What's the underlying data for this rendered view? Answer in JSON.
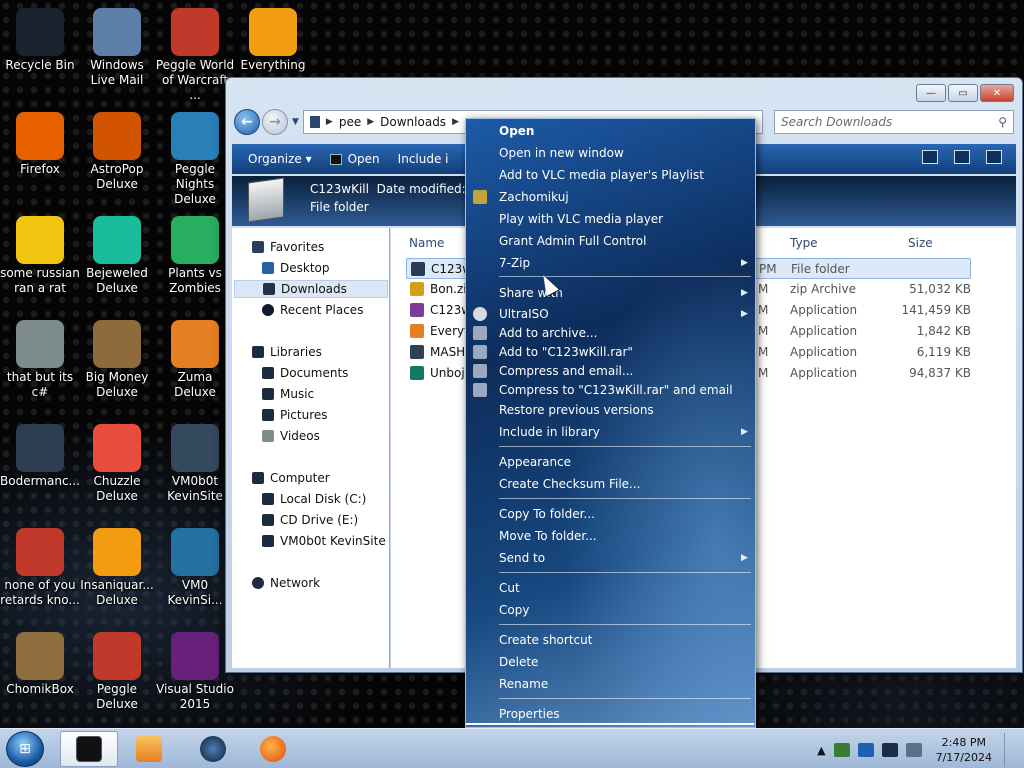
{
  "desktop": {
    "icons": [
      {
        "label": "Recycle Bin",
        "color": "#1b2330"
      },
      {
        "label": "Windows Live Mail",
        "color": "#5b7fa8"
      },
      {
        "label": "Peggle World of Warcraft ...",
        "color": "#c0392b"
      },
      {
        "label": "Everything",
        "color": "#f39c12"
      },
      {
        "label": "Firefox",
        "color": "#e66000"
      },
      {
        "label": "AstroPop Deluxe",
        "color": "#d35400"
      },
      {
        "label": "Peggle Nights Deluxe",
        "color": "#2980b9"
      },
      {
        "label": "some russian ran a rat",
        "color": "#f1c40f"
      },
      {
        "label": "Bejeweled Deluxe",
        "color": "#1abc9c"
      },
      {
        "label": "Plants vs Zombies",
        "color": "#27ae60"
      },
      {
        "label": "that but its c#",
        "color": "#7f8c8d"
      },
      {
        "label": "Big Money Deluxe",
        "color": "#8e6b3a"
      },
      {
        "label": "Zuma Deluxe",
        "color": "#e67e22"
      },
      {
        "label": "Bodermanc...",
        "color": "#2c3e50"
      },
      {
        "label": "Chuzzle Deluxe",
        "color": "#e74c3c"
      },
      {
        "label": "VM0b0t KevinSite",
        "color": "#34495e"
      },
      {
        "label": "none of you retards kno...",
        "color": "#c0392b"
      },
      {
        "label": "Insaniquar... Deluxe",
        "color": "#f39c12"
      },
      {
        "label": "VM0 KevinSi...",
        "color": "#2471a3"
      },
      {
        "label": "ChomikBox",
        "color": "#8d6e3c"
      },
      {
        "label": "Peggle Deluxe",
        "color": "#c0392b"
      },
      {
        "label": "Visual Studio 2015",
        "color": "#68217a"
      }
    ]
  },
  "window": {
    "controls": {
      "minimize": "—",
      "maximize": "▭",
      "close": "✕"
    },
    "breadcrumb": [
      "pee",
      "Downloads"
    ],
    "search_placeholder": "Search Downloads",
    "toolbar": {
      "organize": "Organize ▾",
      "open": "Open",
      "include": "Include i"
    },
    "details": {
      "name": "C123wKill",
      "modified": "Date modified: 7/",
      "type": "File folder"
    },
    "nav": {
      "favorites": "Favorites",
      "desktop": "Desktop",
      "downloads": "Downloads",
      "recent": "Recent Places",
      "libraries": "Libraries",
      "documents": "Documents",
      "music": "Music",
      "pictures": "Pictures",
      "videos": "Videos",
      "computer": "Computer",
      "local_disk": "Local Disk (C:)",
      "cd_drive": "CD Drive (E:)",
      "vm_site": "VM0b0t KevinSite",
      "network": "Network"
    },
    "columns": {
      "name": "Name",
      "type": "Type",
      "size": "Size"
    },
    "files": [
      {
        "name": "C123w",
        "mod": "PM",
        "type": "File folder",
        "size": "",
        "color": "#2a3b55"
      },
      {
        "name": "Bon.zip",
        "mod": "M",
        "type": "zip Archive",
        "size": "51,032 KB",
        "color": "#d4a017"
      },
      {
        "name": "C123w",
        "mod": "M",
        "type": "Application",
        "size": "141,459 KB",
        "color": "#7d3c98"
      },
      {
        "name": "Everyt",
        "mod": "M",
        "type": "Application",
        "size": "1,842 KB",
        "color": "#e67e22"
      },
      {
        "name": "MASH",
        "mod": "M",
        "type": "Application",
        "size": "6,119 KB",
        "color": "#2e4053"
      },
      {
        "name": "Unboj",
        "mod": "M",
        "type": "Application",
        "size": "94,837 KB",
        "color": "#117a65"
      }
    ]
  },
  "context_menu": {
    "open": "Open",
    "open_new_window": "Open in new window",
    "vlc_playlist": "Add to VLC media player's Playlist",
    "zachomikuj": "Zachomikuj",
    "vlc_play": "Play with VLC media player",
    "grant_admin": "Grant Admin Full Control",
    "seven_zip": "7-Zip",
    "share_with": "Share with",
    "ultraiso": "UltraISO",
    "add_archive": "Add to archive...",
    "add_rar": "Add to \"C123wKill.rar\"",
    "compress_email": "Compress and email...",
    "compress_rar_email": "Compress to \"C123wKill.rar\" and email",
    "restore": "Restore previous versions",
    "include_library": "Include in library",
    "appearance": "Appearance",
    "checksum": "Create Checksum File...",
    "copy_to": "Copy To folder...",
    "move_to": "Move To folder...",
    "send_to": "Send to",
    "cut": "Cut",
    "copy": "Copy",
    "create_shortcut": "Create shortcut",
    "delete": "Delete",
    "rename": "Rename",
    "properties": "Properties"
  },
  "taskbar": {
    "time": "2:48 PM",
    "date": "7/17/2024",
    "tray_arrow": "▲"
  }
}
